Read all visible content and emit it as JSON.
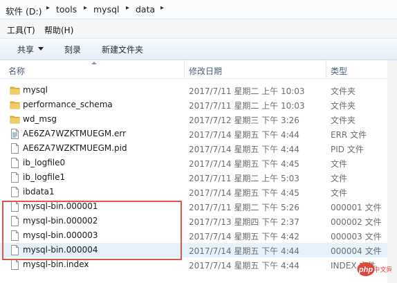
{
  "address_bar": {
    "segments": [
      "软件 (D:)",
      "tools",
      "mysql",
      "data"
    ]
  },
  "menu": {
    "items": [
      "工具(T)",
      "帮助(H)"
    ]
  },
  "toolbar": {
    "share_label": "共享",
    "burn_label": "刻录",
    "new_folder_label": "新建文件夹"
  },
  "columns": {
    "name": "名称",
    "modified": "修改日期",
    "type": "类型"
  },
  "files": [
    {
      "name": "mysql",
      "date": "2017/7/11 星期二 上午 10:03",
      "type": "文件夹",
      "icon": "folder-icon"
    },
    {
      "name": "performance_schema",
      "date": "2017/7/11 星期二 上午 10:03",
      "type": "文件夹",
      "icon": "folder-icon"
    },
    {
      "name": "wd_msg",
      "date": "2017/7/12 星期三 下午 3:26",
      "type": "文件夹",
      "icon": "folder-icon"
    },
    {
      "name": "AE6ZA7WZKTMUEGM.err",
      "date": "2017/7/14 星期五 下午 4:44",
      "type": "ERR 文件",
      "icon": "document-icon"
    },
    {
      "name": "AE6ZA7WZKTMUEGM.pid",
      "date": "2017/7/14 星期五 下午 4:44",
      "type": "PID 文件",
      "icon": "file-icon"
    },
    {
      "name": "ib_logfile0",
      "date": "2017/7/14 星期五 下午 4:45",
      "type": "文件",
      "icon": "file-icon"
    },
    {
      "name": "ib_logfile1",
      "date": "2017/7/11 星期二 上午 5:03",
      "type": "文件",
      "icon": "file-icon"
    },
    {
      "name": "ibdata1",
      "date": "2017/7/14 星期五 下午 4:45",
      "type": "文件",
      "icon": "file-icon"
    },
    {
      "name": "mysql-bin.000001",
      "date": "2017/7/11 星期二 下午 5:26",
      "type": "000001 文件",
      "icon": "file-icon"
    },
    {
      "name": "mysql-bin.000002",
      "date": "2017/7/13 星期四 下午 2:37",
      "type": "000002 文件",
      "icon": "file-icon"
    },
    {
      "name": "mysql-bin.000003",
      "date": "2017/7/14 星期五 下午 4:42",
      "type": "000003 文件",
      "icon": "file-icon"
    },
    {
      "name": "mysql-bin.000004",
      "date": "2017/7/14 星期五 下午 4:44",
      "type": "000004 文件",
      "icon": "file-icon"
    },
    {
      "name": "mysql-bin.index",
      "date": "2017/7/14 星期五 下午 4:44",
      "type": "INDEX 文件",
      "icon": "file-icon"
    }
  ],
  "selected_index": 11,
  "watermark": {
    "text": "php",
    "suffix": "中文网"
  },
  "colors": {
    "folder": "#e8b53a",
    "highlight": "#e1564a",
    "selection": "#e5f1fb",
    "header_text": "#4c607a",
    "watermark": "#e0453e"
  }
}
